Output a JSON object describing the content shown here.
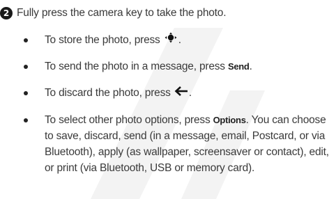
{
  "step": {
    "number": "2",
    "text": "Fully press the camera key to take the photo."
  },
  "bullets": [
    {
      "prefix": "To store the photo, press",
      "icon": "nav-key-center-icon",
      "suffix": "."
    },
    {
      "prefix": "To send the photo in a message, press",
      "key": "Send",
      "suffix": "."
    },
    {
      "prefix": "To discard the photo, press",
      "icon": "back-arrow-icon",
      "suffix": "."
    },
    {
      "prefix": "To select other photo options, press",
      "key": "Options",
      "suffix": ". You can choose to save, discard, send (in a message, email, Postcard, or via Bluetooth), apply (as wallpaper, screensaver or contact), edit, or print (via Bluetooth, USB or memory card)."
    }
  ]
}
